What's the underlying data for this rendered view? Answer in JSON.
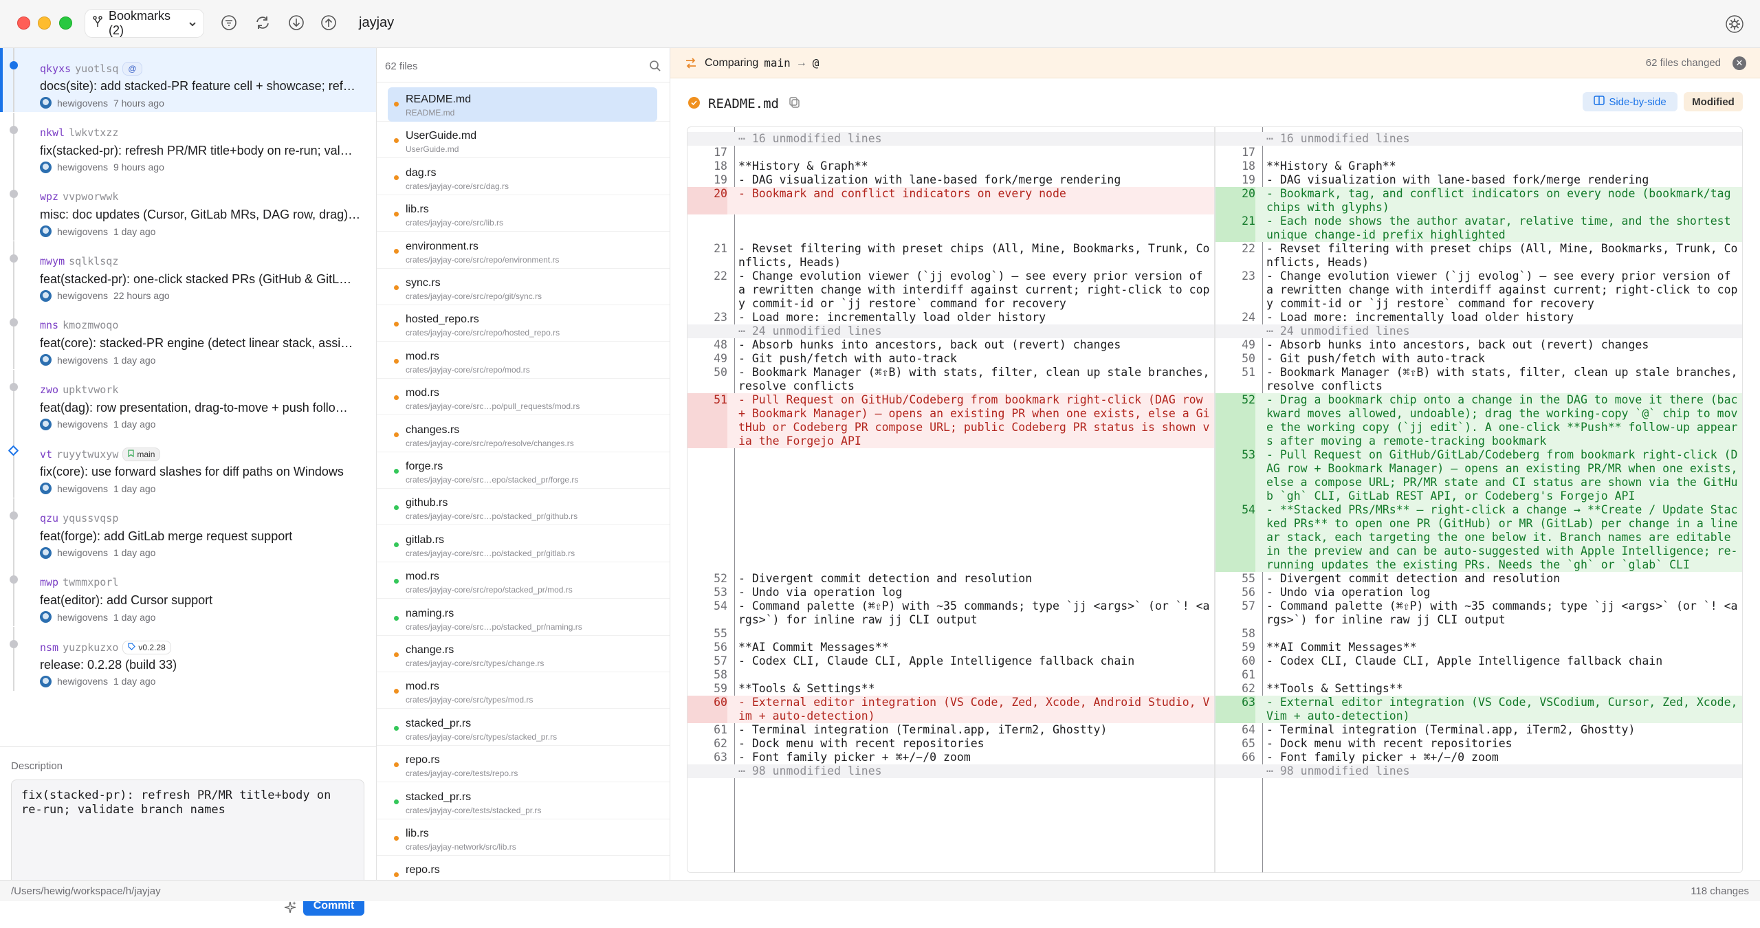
{
  "titlebar": {
    "bookmarks_label": "Bookmarks (2)",
    "repo_name": "jayjay"
  },
  "commits": [
    {
      "id_prefix": "qkyxs",
      "id_rest": "yuotlsq",
      "badge": "@",
      "badge_type": "at",
      "title": "docs(site): add stacked-PR feature cell + showcase; ref…",
      "author": "hewigovens",
      "time": "7 hours ago",
      "node": "blue",
      "selected": true
    },
    {
      "id_prefix": "nkwl",
      "id_rest": "lwkvtxzz",
      "badge": "",
      "title": "fix(stacked-pr): refresh PR/MR title+body on re-run; val…",
      "author": "hewigovens",
      "time": "9 hours ago",
      "node": "gray"
    },
    {
      "id_prefix": "wpz",
      "id_rest": "vvpworwwk",
      "badge": "",
      "title": "misc: doc updates (Cursor, GitLab MRs, DAG row, drag)…",
      "author": "hewigovens",
      "time": "1 day ago",
      "node": "gray"
    },
    {
      "id_prefix": "mwym",
      "id_rest": "sqlklsqz",
      "badge": "",
      "title": "feat(stacked-pr): one-click stacked PRs (GitHub & GitL…",
      "author": "hewigovens",
      "time": "22 hours ago",
      "node": "gray"
    },
    {
      "id_prefix": "mns",
      "id_rest": "kmozmwoqo",
      "badge": "",
      "title": "feat(core): stacked-PR engine (detect linear stack, assi…",
      "author": "hewigovens",
      "time": "1 day ago",
      "node": "gray"
    },
    {
      "id_prefix": "zwo",
      "id_rest": "upktvwork",
      "badge": "",
      "title": "feat(dag): row presentation, drag-to-move + push follo…",
      "author": "hewigovens",
      "time": "1 day ago",
      "node": "gray"
    },
    {
      "id_prefix": "vt",
      "id_rest": "ruyytwuxyw",
      "badge": "main",
      "badge_type": "bookmark",
      "title": "fix(core): use forward slashes for diff paths on Windows",
      "author": "hewigovens",
      "time": "1 day ago",
      "node": "diamond"
    },
    {
      "id_prefix": "qzu",
      "id_rest": "yqussvqsp",
      "badge": "",
      "title": "feat(forge): add GitLab merge request support",
      "author": "hewigovens",
      "time": "1 day ago",
      "node": "gray"
    },
    {
      "id_prefix": "mwp",
      "id_rest": "twmmxporl",
      "badge": "",
      "title": "feat(editor): add Cursor support",
      "author": "hewigovens",
      "time": "1 day ago",
      "node": "gray"
    },
    {
      "id_prefix": "nsm",
      "id_rest": "yuzpkuzxo",
      "badge": "v0.2.28",
      "badge_type": "tag",
      "title": "release: 0.2.28 (build 33)",
      "author": "hewigovens",
      "time": "1 day ago",
      "node": "gray"
    }
  ],
  "description": {
    "label": "Description",
    "text": "fix(stacked-pr): refresh PR/MR title+body on\nre-run; validate branch names",
    "commit_label": "Commit"
  },
  "files_panel": {
    "count_label": "62 files",
    "files": [
      {
        "name": "README.md",
        "path": "README.md",
        "status": "modified",
        "selected": true
      },
      {
        "name": "UserGuide.md",
        "path": "UserGuide.md",
        "status": "modified"
      },
      {
        "name": "dag.rs",
        "path": "crates/jayjay-core/src/dag.rs",
        "status": "modified"
      },
      {
        "name": "lib.rs",
        "path": "crates/jayjay-core/src/lib.rs",
        "status": "modified"
      },
      {
        "name": "environment.rs",
        "path": "crates/jayjay-core/src/repo/environment.rs",
        "status": "modified"
      },
      {
        "name": "sync.rs",
        "path": "crates/jayjay-core/src/repo/git/sync.rs",
        "status": "modified"
      },
      {
        "name": "hosted_repo.rs",
        "path": "crates/jayjay-core/src/repo/hosted_repo.rs",
        "status": "modified"
      },
      {
        "name": "mod.rs",
        "path": "crates/jayjay-core/src/repo/mod.rs",
        "status": "modified"
      },
      {
        "name": "mod.rs",
        "path": "crates/jayjay-core/src…po/pull_requests/mod.rs",
        "status": "modified"
      },
      {
        "name": "changes.rs",
        "path": "crates/jayjay-core/src/repo/resolve/changes.rs",
        "status": "modified"
      },
      {
        "name": "forge.rs",
        "path": "crates/jayjay-core/src…epo/stacked_pr/forge.rs",
        "status": "added"
      },
      {
        "name": "github.rs",
        "path": "crates/jayjay-core/src…po/stacked_pr/github.rs",
        "status": "added"
      },
      {
        "name": "gitlab.rs",
        "path": "crates/jayjay-core/src…po/stacked_pr/gitlab.rs",
        "status": "added"
      },
      {
        "name": "mod.rs",
        "path": "crates/jayjay-core/src/repo/stacked_pr/mod.rs",
        "status": "added"
      },
      {
        "name": "naming.rs",
        "path": "crates/jayjay-core/src…po/stacked_pr/naming.rs",
        "status": "added"
      },
      {
        "name": "change.rs",
        "path": "crates/jayjay-core/src/types/change.rs",
        "status": "modified"
      },
      {
        "name": "mod.rs",
        "path": "crates/jayjay-core/src/types/mod.rs",
        "status": "modified"
      },
      {
        "name": "stacked_pr.rs",
        "path": "crates/jayjay-core/src/types/stacked_pr.rs",
        "status": "added"
      },
      {
        "name": "repo.rs",
        "path": "crates/jayjay-core/tests/repo.rs",
        "status": "modified"
      },
      {
        "name": "stacked_pr.rs",
        "path": "crates/jayjay-core/tests/stacked_pr.rs",
        "status": "added"
      },
      {
        "name": "lib.rs",
        "path": "crates/jayjay-network/src/lib.rs",
        "status": "modified"
      },
      {
        "name": "repo.rs",
        "path": "",
        "status": "modified"
      }
    ]
  },
  "compare": {
    "label": "Comparing",
    "from": "main",
    "arrow": "→",
    "to": "@",
    "files_changed": "62 files changed"
  },
  "file_header": {
    "title": "README.md",
    "view_mode": "Side-by-side",
    "status": "Modified"
  },
  "diff": {
    "left": [
      {
        "t": "sep",
        "n": "",
        "text": "⋯ 16 unmodified lines",
        "h": 1
      },
      {
        "t": "ctx",
        "n": "17",
        "text": "",
        "h": 1
      },
      {
        "t": "ctx",
        "n": "18",
        "text": "**History & Graph**",
        "h": 1
      },
      {
        "t": "ctx",
        "n": "19",
        "text": "- DAG visualization with lane-based fork/merge rendering",
        "h": 1
      },
      {
        "t": "del",
        "n": "20",
        "text": "- Bookmark and conflict indicators on every node",
        "h": 2
      },
      {
        "t": "empty",
        "n": "",
        "text": "",
        "h": 2
      },
      {
        "t": "ctx",
        "n": "21",
        "text": "- Revset filtering with preset chips (All, Mine, Bookmarks, Trunk, Conflicts, Heads)",
        "h": 2
      },
      {
        "t": "ctx",
        "n": "22",
        "text": "- Change evolution viewer (`jj evolog`) — see every prior version of a rewritten change with interdiff against current; right-click to copy commit-id or `jj restore` command for recovery",
        "h": 3
      },
      {
        "t": "ctx",
        "n": "23",
        "text": "- Load more: incrementally load older history",
        "h": 1
      },
      {
        "t": "sep",
        "n": "",
        "text": "⋯ 24 unmodified lines",
        "h": 1
      },
      {
        "t": "ctx",
        "n": "48",
        "text": "- Absorb hunks into ancestors, back out (revert) changes",
        "h": 1
      },
      {
        "t": "ctx",
        "n": "49",
        "text": "- Git push/fetch with auto-track",
        "h": 1
      },
      {
        "t": "ctx",
        "n": "50",
        "text": "- Bookmark Manager (⌘⇧B) with stats, filter, clean up stale branches, resolve conflicts",
        "h": 2
      },
      {
        "t": "del",
        "n": "51",
        "text": "- Pull Request on GitHub/Codeberg from bookmark right-click (DAG row + Bookmark Manager) — opens an existing PR when one exists, else a GitHub or Codeberg PR compose URL; public Codeberg PR status is shown via the Forgejo API",
        "h": 4
      },
      {
        "t": "empty",
        "n": "",
        "text": "",
        "h": 9
      },
      {
        "t": "ctx",
        "n": "52",
        "text": "- Divergent commit detection and resolution",
        "h": 1
      },
      {
        "t": "ctx",
        "n": "53",
        "text": "- Undo via operation log",
        "h": 1
      },
      {
        "t": "ctx",
        "n": "54",
        "text": "- Command palette (⌘⇧P) with ~35 commands; type `jj <args>` (or `! <args>`) for inline raw jj CLI output",
        "h": 2
      },
      {
        "t": "ctx",
        "n": "55",
        "text": "",
        "h": 1
      },
      {
        "t": "ctx",
        "n": "56",
        "text": "**AI Commit Messages**",
        "h": 1
      },
      {
        "t": "ctx",
        "n": "57",
        "text": "- Codex CLI, Claude CLI, Apple Intelligence fallback chain",
        "h": 1
      },
      {
        "t": "ctx",
        "n": "58",
        "text": "",
        "h": 1
      },
      {
        "t": "ctx",
        "n": "59",
        "text": "**Tools & Settings**",
        "h": 1
      },
      {
        "t": "del",
        "n": "60",
        "text": "- External editor integration (VS Code, Zed, Xcode, Android Studio, Vim + auto-detection)",
        "h": 2
      },
      {
        "t": "ctx",
        "n": "61",
        "text": "- Terminal integration (Terminal.app, iTerm2, Ghostty)",
        "h": 1
      },
      {
        "t": "ctx",
        "n": "62",
        "text": "- Dock menu with recent repositories",
        "h": 1
      },
      {
        "t": "ctx",
        "n": "63",
        "text": "- Font family picker + ⌘+/−/0 zoom",
        "h": 1
      },
      {
        "t": "sep",
        "n": "",
        "text": "⋯ 98 unmodified lines",
        "h": 1
      }
    ],
    "right": [
      {
        "t": "sep",
        "n": "",
        "text": "⋯ 16 unmodified lines",
        "h": 1
      },
      {
        "t": "ctx",
        "n": "17",
        "text": "",
        "h": 1
      },
      {
        "t": "ctx",
        "n": "18",
        "text": "**History & Graph**",
        "h": 1
      },
      {
        "t": "ctx",
        "n": "19",
        "text": "- DAG visualization with lane-based fork/merge rendering",
        "h": 1
      },
      {
        "t": "add",
        "n": "20",
        "text": "- Bookmark, tag, and conflict indicators on every node (bookmark/tag chips with glyphs)",
        "h": 2
      },
      {
        "t": "add",
        "n": "21",
        "text": "- Each node shows the author avatar, relative time, and the shortest unique change-id prefix highlighted",
        "h": 2
      },
      {
        "t": "ctx",
        "n": "22",
        "text": "- Revset filtering with preset chips (All, Mine, Bookmarks, Trunk, Conflicts, Heads)",
        "h": 2
      },
      {
        "t": "ctx",
        "n": "23",
        "text": "- Change evolution viewer (`jj evolog`) — see every prior version of a rewritten change with interdiff against current; right-click to copy commit-id or `jj restore` command for recovery",
        "h": 3
      },
      {
        "t": "ctx",
        "n": "24",
        "text": "- Load more: incrementally load older history",
        "h": 1
      },
      {
        "t": "sep",
        "n": "",
        "text": "⋯ 24 unmodified lines",
        "h": 1
      },
      {
        "t": "ctx",
        "n": "49",
        "text": "- Absorb hunks into ancestors, back out (revert) changes",
        "h": 1
      },
      {
        "t": "ctx",
        "n": "50",
        "text": "- Git push/fetch with auto-track",
        "h": 1
      },
      {
        "t": "ctx",
        "n": "51",
        "text": "- Bookmark Manager (⌘⇧B) with stats, filter, clean up stale branches, resolve conflicts",
        "h": 2
      },
      {
        "t": "add",
        "n": "52",
        "text": "- Drag a bookmark chip onto a change in the DAG to move it there (backward moves allowed, undoable); drag the working-copy `@` chip to move the working copy (`jj edit`). A one-click **Push** follow-up appears after moving a remote-tracking bookmark",
        "h": 4
      },
      {
        "t": "add",
        "n": "53",
        "text": "- Pull Request on GitHub/GitLab/Codeberg from bookmark right-click (DAG row + Bookmark Manager) — opens an existing PR/MR when one exists, else a compose URL; PR/MR state and CI status are shown via the GitHub `gh` CLI, GitLab REST API, or Codeberg's Forgejo API",
        "h": 4
      },
      {
        "t": "add",
        "n": "54",
        "text": "- **Stacked PRs/MRs** — right-click a change → **Create / Update Stacked PRs** to open one PR (GitHub) or MR (GitLab) per change in a linear stack, each targeting the one below it. Branch names are editable in the preview and can be auto-suggested with Apple Intelligence; re-running updates the existing PRs. Needs the `gh` or `glab` CLI",
        "h": 5
      },
      {
        "t": "ctx",
        "n": "55",
        "text": "- Divergent commit detection and resolution",
        "h": 1
      },
      {
        "t": "ctx",
        "n": "56",
        "text": "- Undo via operation log",
        "h": 1
      },
      {
        "t": "ctx",
        "n": "57",
        "text": "- Command palette (⌘⇧P) with ~35 commands; type `jj <args>` (or `! <args>`) for inline raw jj CLI output",
        "h": 2
      },
      {
        "t": "ctx",
        "n": "58",
        "text": "",
        "h": 1
      },
      {
        "t": "ctx",
        "n": "59",
        "text": "**AI Commit Messages**",
        "h": 1
      },
      {
        "t": "ctx",
        "n": "60",
        "text": "- Codex CLI, Claude CLI, Apple Intelligence fallback chain",
        "h": 1
      },
      {
        "t": "ctx",
        "n": "61",
        "text": "",
        "h": 1
      },
      {
        "t": "ctx",
        "n": "62",
        "text": "**Tools & Settings**",
        "h": 1
      },
      {
        "t": "add",
        "n": "63",
        "text": "- External editor integration (VS Code, VSCodium, Cursor, Zed, Xcode, Vim + auto-detection)",
        "h": 2
      },
      {
        "t": "ctx",
        "n": "64",
        "text": "- Terminal integration (Terminal.app, iTerm2, Ghostty)",
        "h": 1
      },
      {
        "t": "ctx",
        "n": "65",
        "text": "- Dock menu with recent repositories",
        "h": 1
      },
      {
        "t": "ctx",
        "n": "66",
        "text": "- Font family picker + ⌘+/−/0 zoom",
        "h": 1
      },
      {
        "t": "sep",
        "n": "",
        "text": "⋯ 98 unmodified lines",
        "h": 1
      }
    ]
  },
  "statusbar": {
    "path": "/Users/hewig/workspace/h/jayjay",
    "changes": "118 changes"
  },
  "colors": {
    "accent": "#1a73e8",
    "modified_dot": "#f0901e",
    "added_dot": "#34c759",
    "deleted_bg": "#fdecec",
    "added_bg": "#e6f6e6"
  }
}
